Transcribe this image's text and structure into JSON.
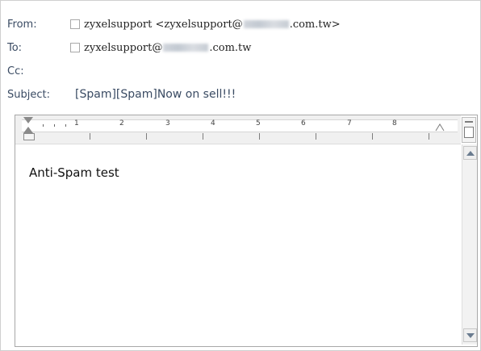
{
  "header": {
    "from_label": "From:",
    "from_prefix": "zyxelsupport <zyxelsupport@",
    "from_suffix": ".com.tw>",
    "to_label": "To:",
    "to_prefix": "zyxelsupport@",
    "to_suffix": ".com.tw",
    "cc_label": "Cc:",
    "subject_label": "Subject:",
    "subject_value": "[Spam][Spam]Now on sell!!!"
  },
  "ruler": {
    "marks": [
      "1",
      "2",
      "3",
      "4",
      "5",
      "6",
      "7",
      "8"
    ]
  },
  "body": {
    "text": "Anti-Spam test"
  },
  "icons": {
    "scroll_up": "arrow-up-icon",
    "scroll_down": "arrow-down-icon",
    "ruler_toggle": "ruler-toggle-icon"
  }
}
